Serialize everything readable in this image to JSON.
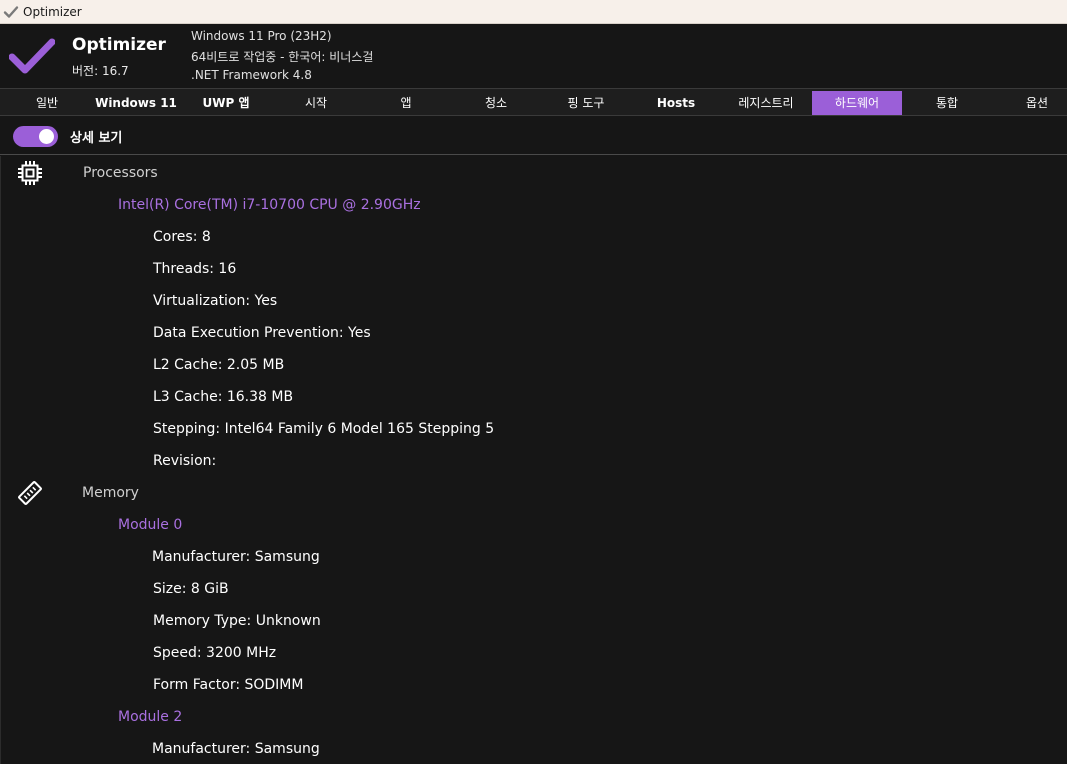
{
  "window": {
    "title": "Optimizer"
  },
  "header": {
    "app_name": "Optimizer",
    "version": "버전: 16.7",
    "os": "Windows 11 Pro (23H2)",
    "arch": "64비트로 작업중 - 한국어: 비너스걸",
    "framework": ".NET Framework 4.8"
  },
  "tabs": [
    {
      "label": "일반",
      "active": false
    },
    {
      "label": "Windows 11",
      "active": false
    },
    {
      "label": "UWP 앱",
      "active": false
    },
    {
      "label": "시작",
      "active": false
    },
    {
      "label": "앱",
      "active": false
    },
    {
      "label": "청소",
      "active": false
    },
    {
      "label": "핑 도구",
      "active": false
    },
    {
      "label": "Hosts",
      "active": false
    },
    {
      "label": "레지스트리",
      "active": false
    },
    {
      "label": "하드웨어",
      "active": true
    },
    {
      "label": "통합",
      "active": false
    },
    {
      "label": "옵션",
      "active": false
    }
  ],
  "detail_toggle": {
    "label": "상세 보기",
    "on": true
  },
  "colors": {
    "accent": "#9b5fd8",
    "subheading": "#a970e0",
    "background": "#161616"
  },
  "hardware": {
    "processors": {
      "label": "Processors",
      "icon": "cpu-icon",
      "name": "Intel(R) Core(TM) i7-10700 CPU @ 2.90GHz",
      "details": [
        "Cores: 8",
        "Threads: 16",
        "Virtualization: Yes",
        "Data Execution Prevention: Yes",
        "L2 Cache: 2.05 MB",
        "L3 Cache: 16.38 MB",
        "Stepping: Intel64 Family 6 Model 165 Stepping 5",
        "Revision:"
      ]
    },
    "memory": {
      "label": "Memory",
      "icon": "memory-icon",
      "modules": [
        {
          "name": "Module 0",
          "details": [
            "Manufacturer: Samsung",
            "Size: 8 GiB",
            "Memory Type: Unknown",
            "Speed: 3200 MHz",
            "Form Factor: SODIMM"
          ]
        },
        {
          "name": "Module 2",
          "details": [
            "Manufacturer: Samsung"
          ]
        }
      ]
    }
  }
}
